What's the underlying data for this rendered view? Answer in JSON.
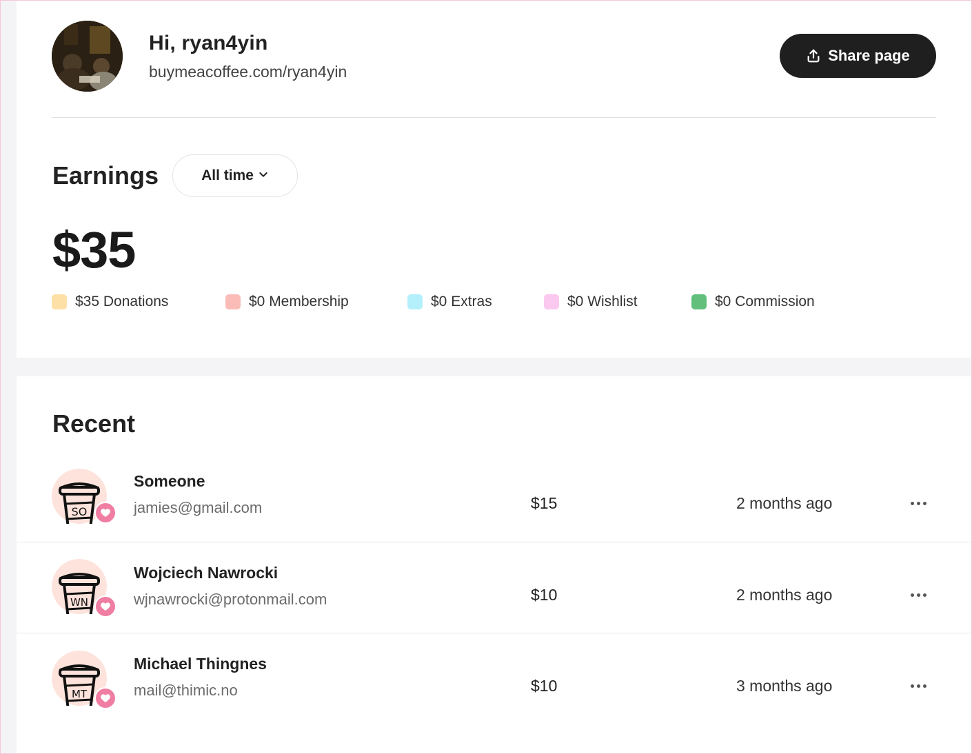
{
  "header": {
    "greeting": "Hi, ryan4yin",
    "profile_url": "buymeacoffee.com/ryan4yin",
    "share_label": "Share page"
  },
  "earnings": {
    "title": "Earnings",
    "period": "All time",
    "total": "$35",
    "breakdown": [
      {
        "label": "$35 Donations",
        "color": "#fde0a6"
      },
      {
        "label": "$0 Membership",
        "color": "#fbbcb8"
      },
      {
        "label": "$0 Extras",
        "color": "#b3f0fb"
      },
      {
        "label": "$0 Wishlist",
        "color": "#fbc8ef"
      },
      {
        "label": "$0 Commission",
        "color": "#62c07c"
      }
    ]
  },
  "recent": {
    "title": "Recent",
    "items": [
      {
        "initials": "SO",
        "name": "Someone",
        "email": "jamies@gmail.com",
        "amount": "$15",
        "time": "2 months ago"
      },
      {
        "initials": "WN",
        "name": "Wojciech Nawrocki",
        "email": "wjnawrocki@protonmail.com",
        "amount": "$10",
        "time": "2 months ago"
      },
      {
        "initials": "MT",
        "name": "Michael Thingnes",
        "email": "mail@thimic.no",
        "amount": "$10",
        "time": "3 months ago"
      }
    ]
  },
  "icons": {
    "share": "share-upload-icon",
    "dropdown": "chevron-down-icon",
    "more": "more-horizontal-icon",
    "heart": "heart-icon",
    "cup": "coffee-cup-icon"
  },
  "colors": {
    "button_dark": "#1f1f1f",
    "heart_badge": "#f07da2",
    "cup_bg": "#fde3dc"
  }
}
